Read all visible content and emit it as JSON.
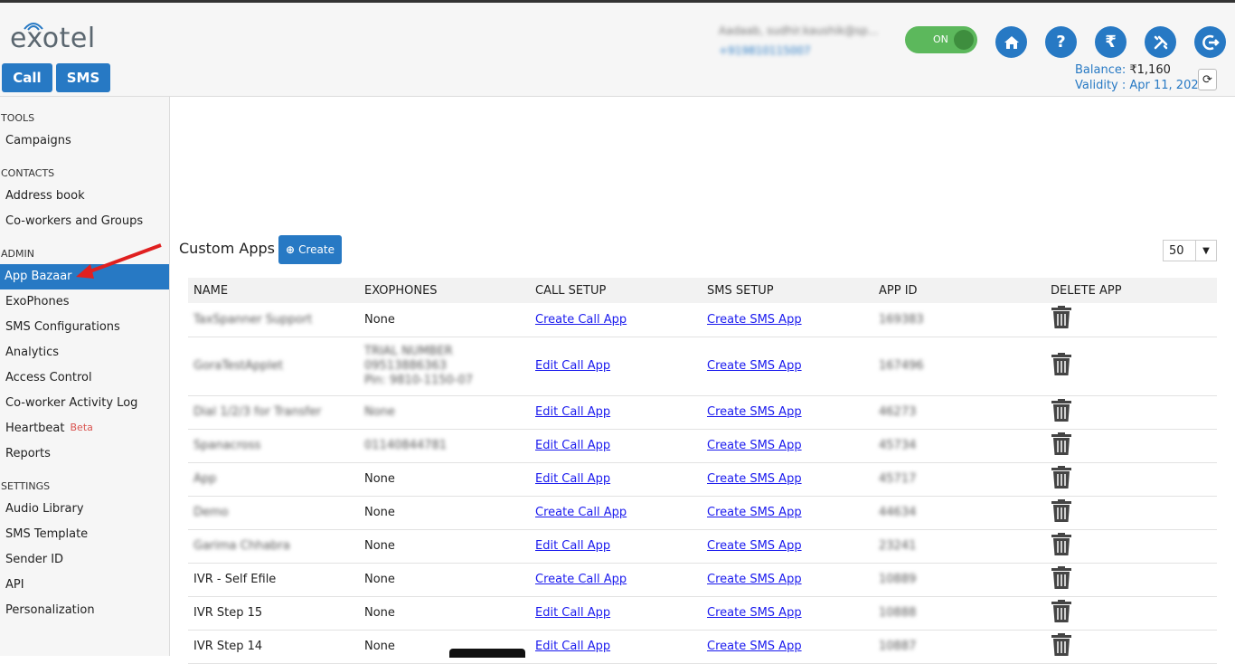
{
  "header": {
    "logo": "exotel",
    "call_label": "Call",
    "sms_label": "SMS",
    "user_name": "Aadaab, sudhir.kaushik@sp...",
    "user_phone": "+919810115007",
    "toggle_label": "ON",
    "icons": [
      "home-icon",
      "help-icon",
      "rupee-icon",
      "tools-icon",
      "logout-icon"
    ],
    "balance_label": "Balance:",
    "balance_value": "₹1,160",
    "validity_label": "Validity : Apr 11, 2020",
    "accent_color": "#2779c4"
  },
  "sidebar": {
    "tools_heading": "TOOLS",
    "campaigns": "Campaigns",
    "contacts_heading": "CONTACTS",
    "address_book": "Address book",
    "coworkers": "Co-workers and Groups",
    "admin_heading": "ADMIN",
    "app_bazaar": "App Bazaar",
    "exophones": "ExoPhones",
    "sms_config": "SMS Configurations",
    "analytics": "Analytics",
    "access_control": "Access Control",
    "activity_log": "Co-worker Activity Log",
    "heartbeat": "Heartbeat",
    "beta": "Beta",
    "reports": "Reports",
    "settings_heading": "SETTINGS",
    "audio_library": "Audio Library",
    "sms_template": "SMS Template",
    "sender_id": "Sender ID",
    "api": "API",
    "personalization": "Personalization"
  },
  "main": {
    "title": "Custom Apps",
    "create_label": "Create",
    "page_size": "50",
    "columns": [
      "NAME",
      "EXOPHONES",
      "CALL SETUP",
      "SMS SETUP",
      "APP ID",
      "DELETE APP"
    ],
    "rows": [
      {
        "name": "TaxSpanner Support",
        "exophones": "None",
        "call": "Create Call App",
        "sms": "Create SMS App",
        "app_id": "169383"
      },
      {
        "name": "GoraTestApplet",
        "exo1": "TRIAL NUMBER",
        "exo2": "09513886363",
        "exo3": "Pin: 9810-1150-07",
        "call": "Edit Call App",
        "sms": "Create SMS App",
        "app_id": "167496"
      },
      {
        "name": "Dial 1/2/3 for Transfer",
        "exophones": "None",
        "call": "Edit Call App",
        "sms": "Create SMS App",
        "app_id": "46273"
      },
      {
        "name": "Spanacross",
        "exophones": "01140844781",
        "call": "Edit Call App",
        "sms": "Create SMS App",
        "app_id": "45734"
      },
      {
        "name": "App",
        "exophones": "None",
        "call": "Edit Call App",
        "sms": "Create SMS App",
        "app_id": "45717"
      },
      {
        "name": "Demo",
        "exophones": "None",
        "call": "Create Call App",
        "sms": "Create SMS App",
        "app_id": "44634"
      },
      {
        "name": "Garima Chhabra",
        "exophones": "None",
        "call": "Edit Call App",
        "sms": "Create SMS App",
        "app_id": "23241"
      },
      {
        "name": "IVR - Self Efile",
        "exophones": "None",
        "call": "Create Call App",
        "sms": "Create SMS App",
        "app_id": "10889"
      },
      {
        "name": "IVR Step 15",
        "exophones": "None",
        "call": "Edit Call App",
        "sms": "Create SMS App",
        "app_id": "10888"
      },
      {
        "name": "IVR Step 14",
        "exophones": "None",
        "call": "Edit Call App",
        "sms": "Create SMS App",
        "app_id": "10887"
      }
    ]
  }
}
